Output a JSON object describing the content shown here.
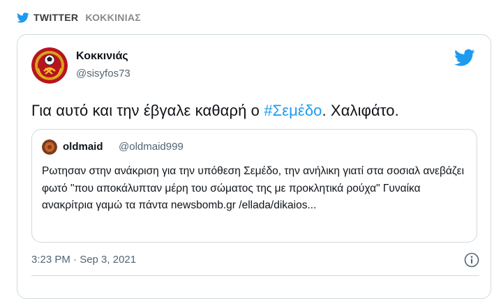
{
  "header": {
    "platform_label": "TWITTER",
    "account_label": "ΚΟΚΚΙΝΙΑΣ",
    "bird_icon_color": "#1d9bf0"
  },
  "tweet": {
    "author_name": "Κοκκινιάς",
    "author_handle": "@sisyfos73",
    "text_before": "Για αυτό και την έβγαλε καθαρή ο ",
    "hashtag": "#Σεμέδο",
    "text_after": ". Χαλιφάτο.",
    "timestamp": "3:23 PM · Sep 3, 2021",
    "hashtag_color": "#1d9bf0"
  },
  "quoted_tweet": {
    "author_name": "oldmaid",
    "author_handle": "@oldmaid999",
    "text": "Ρωτησαν στην ανάκριση για την υπόθεση Σεμέδο, την ανήλικη γιατί στα σοσιαλ ανεβάζει φωτό \"που αποκάλυπταν μέρη του σώματος της με προκλητικά ρούχα\" Γυναίκα ανακρίτρια γαμώ τα πάντα newsbomb.gr /ellada/dikaios..."
  }
}
